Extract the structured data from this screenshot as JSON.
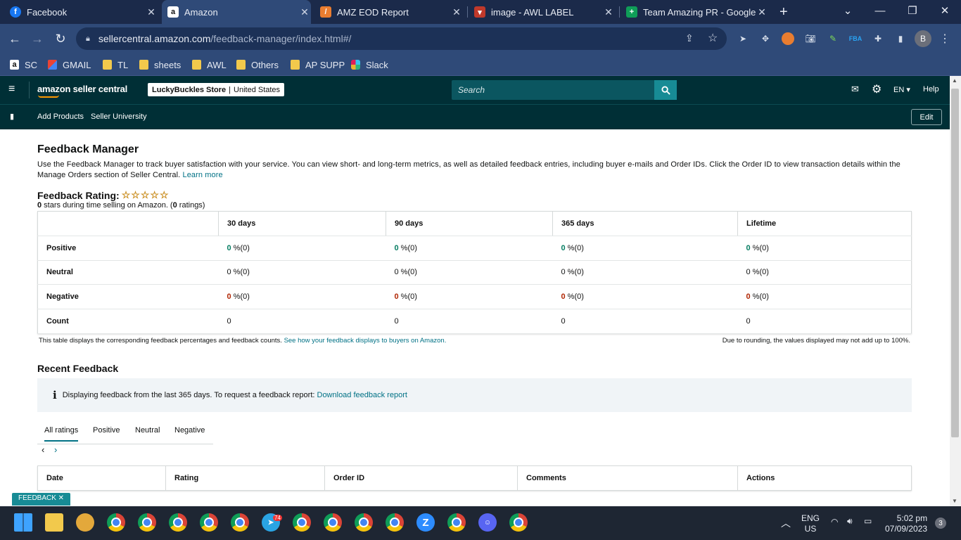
{
  "browser": {
    "tabs": [
      {
        "title": "Facebook",
        "icon": "facebook-icon",
        "active": false
      },
      {
        "title": "Amazon",
        "icon": "amazon-icon",
        "active": true
      },
      {
        "title": "AMZ EOD Report",
        "icon": "report-icon",
        "active": false
      },
      {
        "title": "image - AWL LABEL",
        "icon": "awl-icon",
        "active": false
      },
      {
        "title": "Team Amazing PR - Google S",
        "icon": "sheets-icon",
        "active": false
      }
    ],
    "url_domain": "sellercentral.amazon.com",
    "url_path": "/feedback-manager/index.html#/",
    "profile_initial": "B",
    "bookmarks": [
      {
        "label": "SC",
        "icon": "amazon-icon"
      },
      {
        "label": "GMAIL",
        "icon": "gmail-icon"
      },
      {
        "label": "TL",
        "icon": "folder-icon"
      },
      {
        "label": "sheets",
        "icon": "folder-icon"
      },
      {
        "label": "AWL",
        "icon": "folder-icon"
      },
      {
        "label": "Others",
        "icon": "folder-icon"
      },
      {
        "label": "AP SUPP",
        "icon": "folder-icon"
      },
      {
        "label": "Slack",
        "icon": "slack-icon"
      }
    ]
  },
  "seller_central": {
    "logo": "amazon seller central",
    "store_name": "LuckyBuckles Store",
    "store_region": "United States",
    "search_placeholder": "Search",
    "language": "EN",
    "help": "Help",
    "nav": [
      "Add Products",
      "Seller University"
    ],
    "edit": "Edit"
  },
  "feedback_manager": {
    "title": "Feedback Manager",
    "description": "Use the Feedback Manager to track buyer satisfaction with your service. You can view short- and long-term metrics, as well as detailed feedback entries, including buyer e-mails and Order IDs. Click the Order ID to view transaction details within the Manage Orders section of Seller Central.",
    "learn_more": "Learn more",
    "rating_label": "Feedback Rating:",
    "stars_value": "0",
    "stars_text": " stars during time selling on Amazon. (",
    "ratings_count": "0",
    "ratings_text": " ratings)",
    "stars_shown": 0,
    "stars_total": 5,
    "columns": [
      "30 days",
      "90 days",
      "365 days",
      "Lifetime"
    ],
    "rows": [
      {
        "label": "Positive",
        "type": "pos",
        "values": [
          "0",
          "0",
          "0",
          "0"
        ],
        "suffix": " %(0)"
      },
      {
        "label": "Neutral",
        "type": "neu",
        "values": [
          "0",
          "0",
          "0",
          "0"
        ],
        "suffix": " %(0)"
      },
      {
        "label": "Negative",
        "type": "neg",
        "values": [
          "0",
          "0",
          "0",
          "0"
        ],
        "suffix": " %(0)"
      },
      {
        "label": "Count",
        "type": "count",
        "values": [
          "0",
          "0",
          "0",
          "0"
        ],
        "suffix": ""
      }
    ],
    "table_note": "This table displays the corresponding feedback percentages and feedback counts.",
    "table_note_link": "See how your feedback displays to buyers on Amazon.",
    "rounding_note": "Due to rounding, the values displayed may not add up to 100%."
  },
  "recent_feedback": {
    "title": "Recent Feedback",
    "info_text": "Displaying feedback from the last 365 days. To request a feedback report:",
    "info_link": "Download feedback report",
    "tabs": [
      "All ratings",
      "Positive",
      "Neutral",
      "Negative"
    ],
    "columns": [
      "Date",
      "Rating",
      "Order ID",
      "Comments",
      "Actions"
    ],
    "feedback_tag": "FEEDBACK"
  },
  "taskbar": {
    "language": "ENG",
    "region": "US",
    "time": "5:02 pm",
    "date": "07/09/2023",
    "notifications": "3",
    "telegram_badge": "74"
  }
}
